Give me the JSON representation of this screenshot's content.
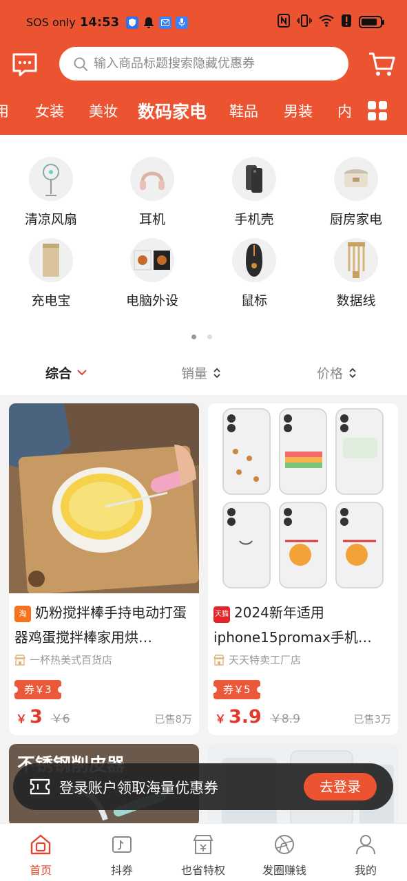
{
  "status_bar": {
    "network": "SOS only",
    "time": "14:53",
    "battery_level": 0.85
  },
  "search": {
    "placeholder": "输入商品标题搜索隐藏优惠券"
  },
  "category_tabs": [
    {
      "label": "用",
      "active": false
    },
    {
      "label": "女装",
      "active": false
    },
    {
      "label": "美妆",
      "active": false
    },
    {
      "label": "数码家电",
      "active": true
    },
    {
      "label": "鞋品",
      "active": false
    },
    {
      "label": "男装",
      "active": false
    },
    {
      "label": "内",
      "active": false
    }
  ],
  "subcategories": [
    {
      "label": "清凉风扇",
      "icon": "fan-icon"
    },
    {
      "label": "耳机",
      "icon": "headphones-icon"
    },
    {
      "label": "手机壳",
      "icon": "phone-case-icon"
    },
    {
      "label": "厨房家电",
      "icon": "rice-cooker-icon"
    },
    {
      "label": "充电宝",
      "icon": "power-bank-icon"
    },
    {
      "label": "电脑外设",
      "icon": "speaker-icon"
    },
    {
      "label": "鼠标",
      "icon": "mouse-icon"
    },
    {
      "label": "数据线",
      "icon": "cable-icon"
    }
  ],
  "pager": {
    "pages": 2,
    "current": 1
  },
  "sort": [
    {
      "label": "综合",
      "active": true
    },
    {
      "label": "销量",
      "active": false
    },
    {
      "label": "价格",
      "active": false
    }
  ],
  "products": [
    {
      "platform": "淘",
      "platform_color": "#f5731e",
      "title": "奶粉搅拌棒手持电动打蛋器鸡蛋搅拌棒家用烘…",
      "shop": "一杯热美式百货店",
      "coupon": "券￥3",
      "currency": "￥",
      "price": "3",
      "original_price": "￥6",
      "sold": "已售8万"
    },
    {
      "platform": "天猫",
      "platform_color": "#e3242b",
      "title": "2024新年适用iphone15promax手机…",
      "shop": "天天特卖工厂店",
      "coupon": "券￥5",
      "currency": "￥",
      "price": "3.9",
      "original_price": "￥8.9",
      "sold": "已售3万"
    }
  ],
  "product_previews": [
    {
      "overlay_text": "不锈钢削皮器"
    },
    {
      "overlay_text": ""
    }
  ],
  "login_banner": {
    "text": "登录账户领取海量优惠券",
    "button": "去登录"
  },
  "bottom_nav": [
    {
      "label": "首页",
      "active": true
    },
    {
      "label": "抖券",
      "active": false
    },
    {
      "label": "也省特权",
      "active": false
    },
    {
      "label": "发圈赚钱",
      "active": false
    },
    {
      "label": "我的",
      "active": false
    }
  ],
  "colors": {
    "brand": "#ec5331",
    "price": "#e23a2a"
  }
}
